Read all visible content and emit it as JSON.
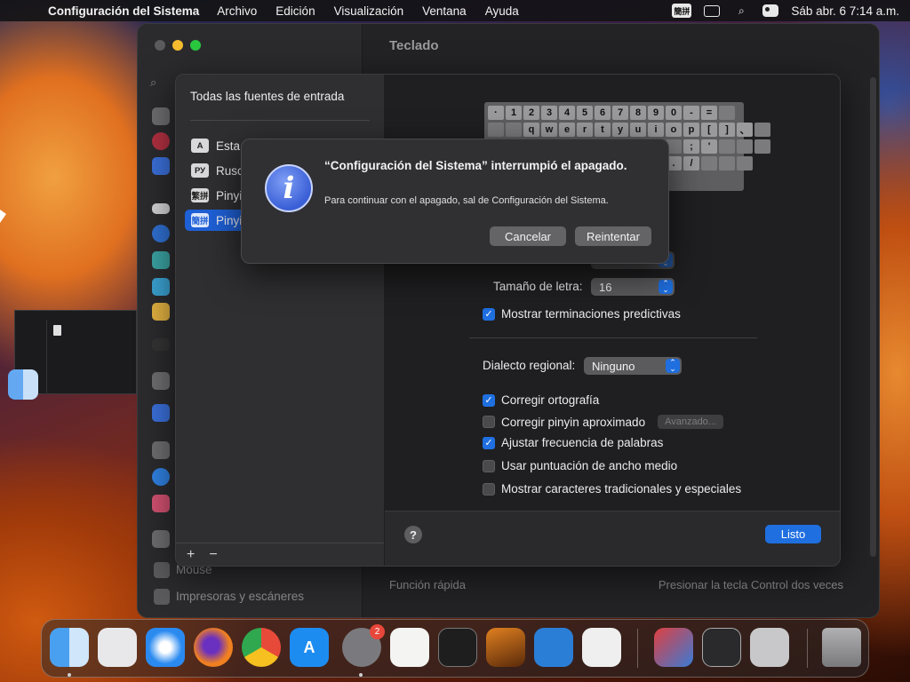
{
  "menubar": {
    "app_name": "Configuración del Sistema",
    "menus": [
      "Archivo",
      "Edición",
      "Visualización",
      "Ventana",
      "Ayuda"
    ],
    "input_badge": "簡拼",
    "clock": "Sáb abr. 6  7:14 a.m."
  },
  "settings": {
    "title": "Teclado",
    "sidebar_bottom": [
      "Mouse",
      "Impresoras y escáneres"
    ],
    "quick_function_label": "Función rápida",
    "quick_function_value": "Presionar la tecla Control dos veces"
  },
  "input_sources": {
    "title": "Todas las fuentes de entrada",
    "items": [
      {
        "icon": "A",
        "label": "Esta"
      },
      {
        "icon": "РУ",
        "label": "Rusc"
      },
      {
        "icon": "繁拼",
        "label": "Pinyi"
      },
      {
        "icon": "簡拼",
        "label": "Pinyi"
      }
    ],
    "add_label": "+",
    "remove_label": "−"
  },
  "keyboard_rows": [
    [
      "·",
      "1",
      "2",
      "3",
      "4",
      "5",
      "6",
      "7",
      "8",
      "9",
      "0",
      "-",
      "="
    ],
    [
      "q",
      "w",
      "e",
      "r",
      "t",
      "y",
      "u",
      "i",
      "o",
      "p",
      "[",
      "]",
      "、"
    ],
    [
      ";",
      "'"
    ],
    [
      ".",
      "/"
    ]
  ],
  "options": {
    "font_size_label": "Tamaño de letra:",
    "font_size_value": "16",
    "predictive_label": "Mostrar terminaciones predictivas",
    "predictive_checked": true,
    "dialect_label": "Dialecto regional:",
    "dialect_value": "Ninguno",
    "spelling_label": "Corregir ortografía",
    "spelling_checked": true,
    "fuzzy_label": "Corregir pinyin aproximado",
    "fuzzy_checked": false,
    "advanced_label": "Avanzado...",
    "frequency_label": "Ajustar frecuencia de palabras",
    "frequency_checked": true,
    "halfwidth_label": "Usar puntuación de ancho medio",
    "halfwidth_checked": false,
    "traditional_label": "Mostrar caracteres tradicionales y especiales",
    "traditional_checked": false
  },
  "sheet_footer": {
    "help_label": "?",
    "done_label": "Listo"
  },
  "alert": {
    "icon": "i",
    "title": "“Configuración del Sistema” interrumpió el apagado.",
    "message": "Para continuar con el apagado, sal de Configuración del Sistema.",
    "cancel_label": "Cancelar",
    "restart_label": "Reintentar"
  },
  "dock": {
    "system_settings_badge": "2",
    "apps": [
      "finder",
      "launchpad",
      "safari",
      "firefox",
      "chrome",
      "app-store",
      "system-settings",
      "textedit",
      "terminal",
      "garageband",
      "vscode",
      "roblox",
      "remote-desktop",
      "bbedit",
      "calculator",
      "trash"
    ]
  },
  "colors": {
    "accent": "#1f6fe0",
    "selection": "#1e60d6",
    "badge": "#e8473b"
  }
}
